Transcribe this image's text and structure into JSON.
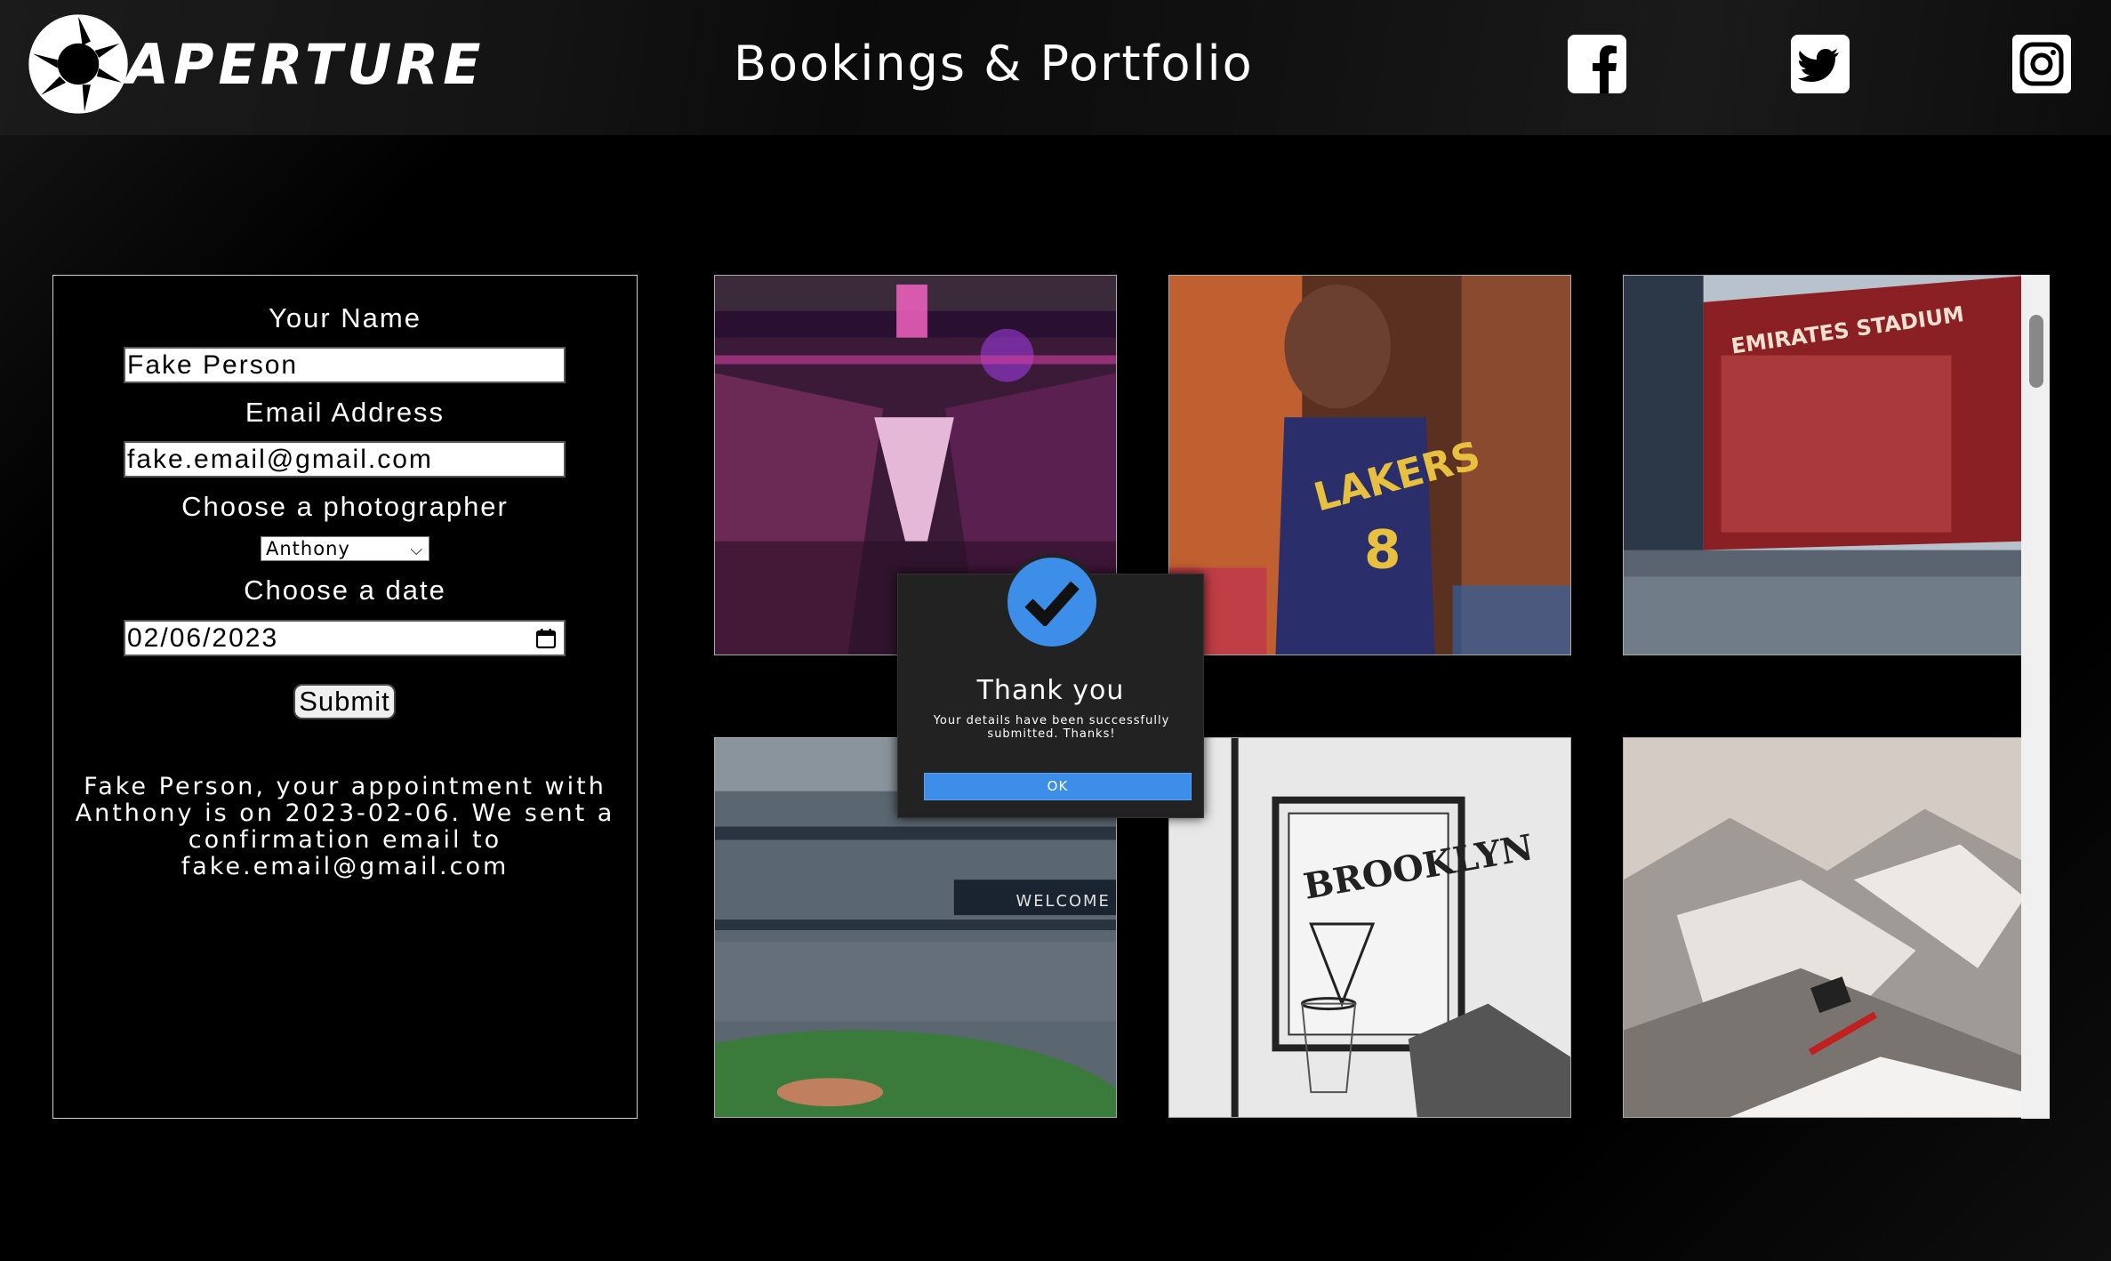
{
  "header": {
    "logo_text": "APERTURE",
    "title": "Bookings & Portfolio",
    "social": [
      {
        "name": "facebook-icon"
      },
      {
        "name": "twitter-icon"
      },
      {
        "name": "instagram-icon"
      }
    ]
  },
  "form": {
    "name_label": "Your Name",
    "name_value": "Fake Person",
    "email_label": "Email Address",
    "email_value": "fake.email@gmail.com",
    "photographer_label": "Choose a photographer",
    "photographer_value": "Anthony",
    "date_label": "Choose a date",
    "date_value": "02/06/2023",
    "submit_label": "Submit",
    "confirmation": "Fake Person, your appointment with Anthony is on 2023-02-06. We sent a confirmation email to fake.email@gmail.com"
  },
  "gallery": {
    "tiles": [
      {
        "subject": "arena-photo"
      },
      {
        "subject": "lakers-mural-photo"
      },
      {
        "subject": "emirates-stadium-photo"
      },
      {
        "subject": "baseball-stadium-photo"
      },
      {
        "subject": "brooklyn-hoop-photo"
      },
      {
        "subject": "snowboarder-photo"
      }
    ]
  },
  "dialog": {
    "title": "Thank you",
    "message": "Your details have been successfully submitted. Thanks!",
    "ok_label": "OK"
  },
  "colors": {
    "background": "#000000",
    "accent": "#3d8ee8",
    "dialog_bg": "#222222"
  }
}
